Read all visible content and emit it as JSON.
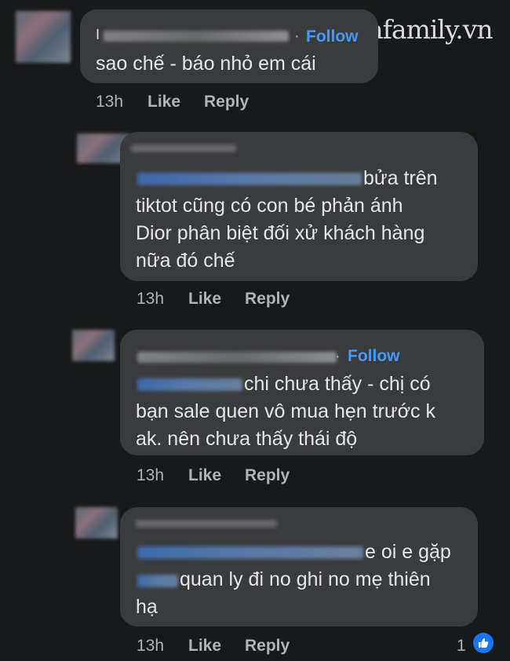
{
  "watermark": "afamily.vn",
  "comments": [
    {
      "author_suffix": "I",
      "follow_label": "Follow",
      "separator": "·",
      "lines": [
        "sao chế - báo nhỏ em cái"
      ],
      "time": "13h",
      "like_label": "Like",
      "reply_label": "Reply"
    },
    {
      "lines": [
        "bửa trên",
        "tiktot cũng có con bé phản ánh",
        "Dior phân biệt đối xử khách hàng",
        "nữa đó chế"
      ],
      "time": "13h",
      "like_label": "Like",
      "reply_label": "Reply"
    },
    {
      "follow_label": "Follow",
      "separator": "·",
      "lines": [
        "chi chưa thấy - chị có",
        "bạn sale quen vô mua hẹn trước k",
        "ak. nên chưa thấy thái độ"
      ],
      "time": "13h",
      "like_label": "Like",
      "reply_label": "Reply"
    },
    {
      "lines": [
        "e oi e gặp",
        "quan ly đi no ghi no mẹ thiên",
        "hạ"
      ],
      "time": "13h",
      "like_label": "Like",
      "reply_label": "Reply",
      "reaction_count": "1",
      "reaction_icon": "thumbs-up-icon"
    }
  ],
  "colors": {
    "background": "#18191a",
    "bubble": "#3a3b3c",
    "follow": "#4599ff",
    "like_badge": "#1877f2"
  }
}
